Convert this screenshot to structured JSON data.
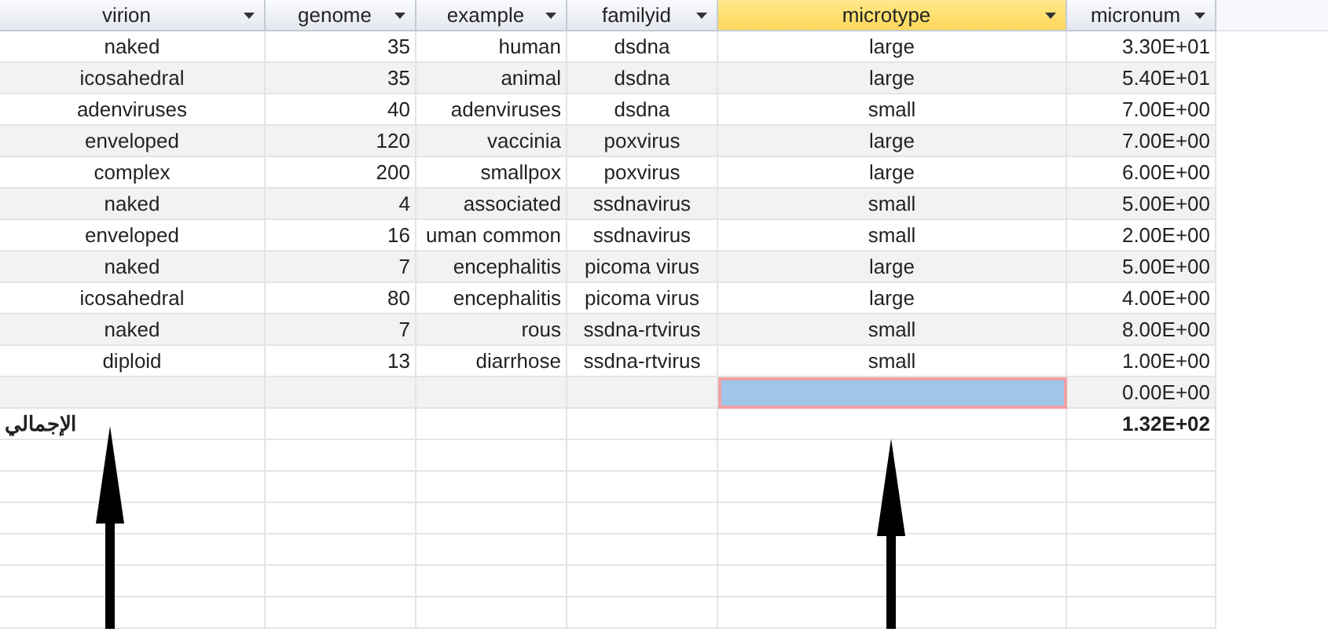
{
  "columns": [
    {
      "label": "virion",
      "selected": false
    },
    {
      "label": "genome",
      "selected": false
    },
    {
      "label": "example",
      "selected": false
    },
    {
      "label": "familyid",
      "selected": false
    },
    {
      "label": "microtype",
      "selected": true
    },
    {
      "label": "micronum",
      "selected": false
    }
  ],
  "rows": [
    [
      "naked",
      "35",
      "human",
      "dsdna",
      "large",
      "3.30E+01"
    ],
    [
      "icosahedral",
      "35",
      "animal",
      "dsdna",
      "large",
      "5.40E+01"
    ],
    [
      "adenviruses",
      "40",
      "adenviruses",
      "dsdna",
      "small",
      "7.00E+00"
    ],
    [
      "enveloped",
      "120",
      "vaccinia",
      "poxvirus",
      "large",
      "7.00E+00"
    ],
    [
      "complex",
      "200",
      "smallpox",
      "poxvirus",
      "large",
      "6.00E+00"
    ],
    [
      "naked",
      "4",
      "associated",
      "ssdnavirus",
      "small",
      "5.00E+00"
    ],
    [
      "enveloped",
      "16",
      "uman common",
      "ssdnavirus",
      "small",
      "2.00E+00"
    ],
    [
      "naked",
      "7",
      "encephalitis",
      "picoma virus",
      "large",
      "5.00E+00"
    ],
    [
      "icosahedral",
      "80",
      "encephalitis",
      "picoma virus",
      "large",
      "4.00E+00"
    ],
    [
      "naked",
      "7",
      "rous",
      "ssdna-rtvirus",
      "small",
      "8.00E+00"
    ],
    [
      "diploid",
      "13",
      "diarrhose",
      "ssdna-rtvirus",
      "small",
      "1.00E+00"
    ]
  ],
  "new_row": [
    {
      "selected": false
    },
    {
      "selected": false
    },
    {
      "selected": false
    },
    {
      "selected": false
    },
    {
      "selected": true
    },
    {
      "text": "0.00E+00",
      "selected": false
    }
  ],
  "total_row": {
    "label": "الإجمالي",
    "micronum": "1.32E+02"
  }
}
